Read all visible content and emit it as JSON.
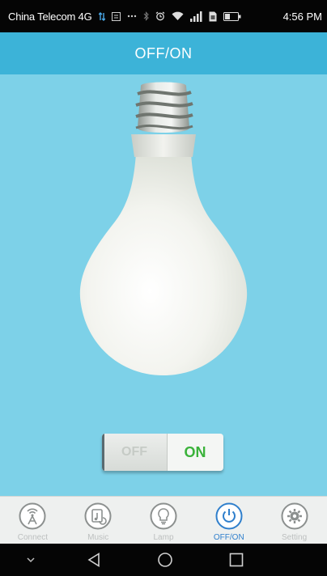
{
  "status_bar": {
    "carrier": "China Telecom 4G",
    "time": "4:56 PM"
  },
  "title_bar": {
    "title": "OFF/ON"
  },
  "power_switch": {
    "off_label": "OFF",
    "on_label": "ON",
    "state": "on"
  },
  "tabs": [
    {
      "label": "Connect",
      "icon": "antenna-icon",
      "active": false
    },
    {
      "label": "Music",
      "icon": "music-icon",
      "active": false
    },
    {
      "label": "Lamp",
      "icon": "bulb-icon",
      "active": false
    },
    {
      "label": "OFF/ON",
      "icon": "power-icon",
      "active": true
    },
    {
      "label": "Setting",
      "icon": "gear-icon",
      "active": false
    }
  ],
  "colors": {
    "title_bar": "#3cb3d8",
    "background": "#7dd1e8",
    "on_green": "#3ab23a",
    "active_tab": "#2f7fcc",
    "inactive_tab": "#bcbfbf"
  }
}
